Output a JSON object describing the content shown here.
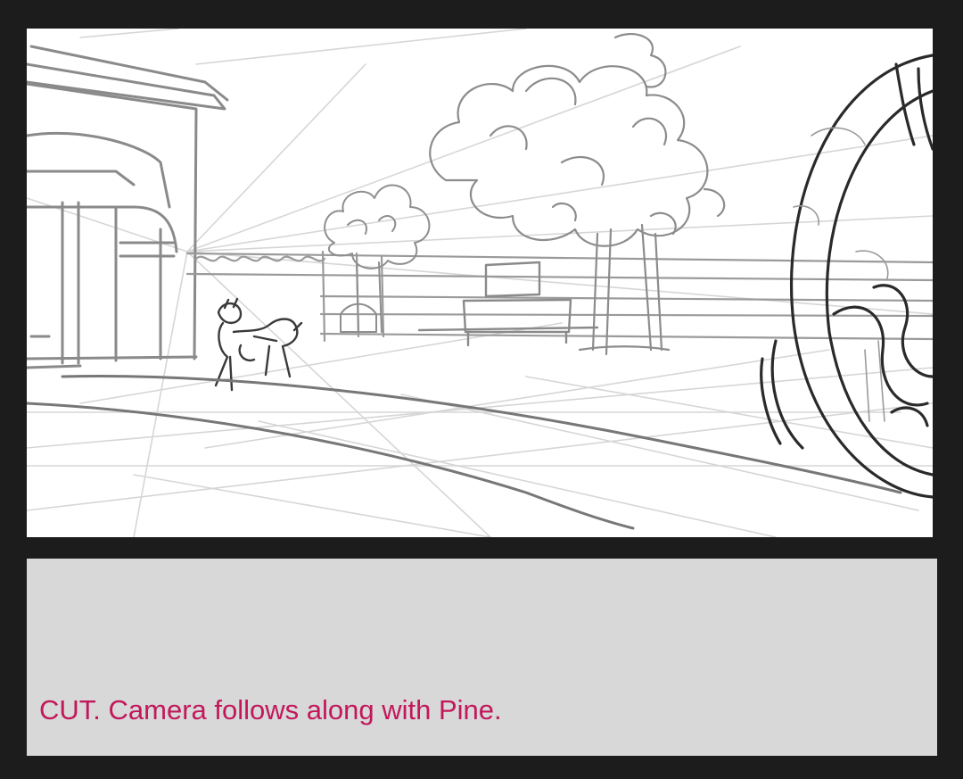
{
  "storyboard": {
    "caption": "CUT. Camera follows along with Pine.",
    "caption_color": "#c2185b",
    "panel_background": "#ffffff",
    "notes_background": "#d8d8d8",
    "page_background": "#1c1c1c"
  }
}
